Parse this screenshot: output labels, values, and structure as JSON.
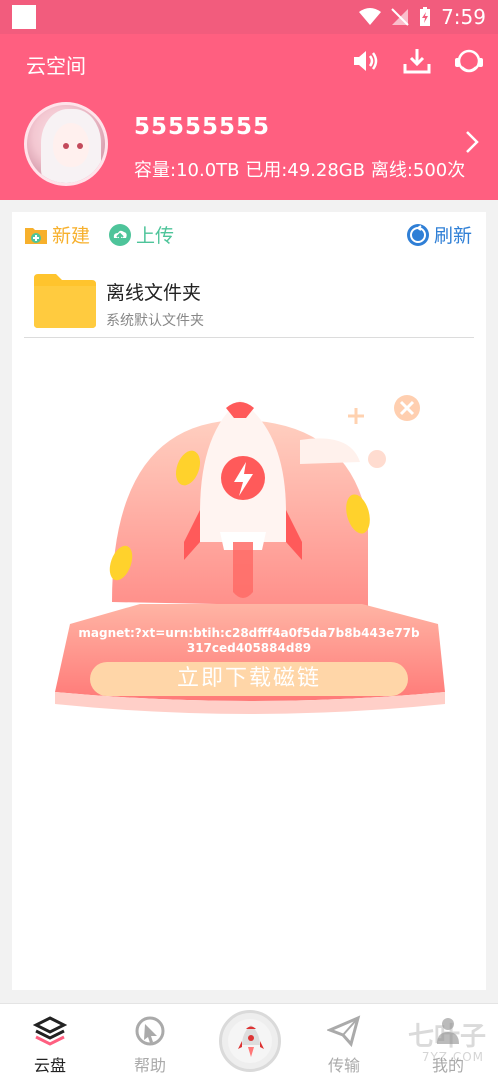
{
  "status_bar": {
    "time": "7:59"
  },
  "header": {
    "title": "云空间",
    "icons": [
      "speaker-icon",
      "download-icon",
      "headset-icon"
    ],
    "username": "55555555",
    "quota": "容量:10.0TB 已用:49.28GB 离线:500次"
  },
  "toolbar": {
    "new_label": "新建",
    "upload_label": "上传",
    "refresh_label": "刷新"
  },
  "folders": [
    {
      "name": "离线文件夹",
      "subtitle": "系统默认文件夹"
    }
  ],
  "promo": {
    "magnet": "magnet:?xt=urn:btih:c28dfff4a0f5da7b8b443e77b317ced405884d89",
    "button_label": "立即下载磁链"
  },
  "tabs": [
    {
      "label": "云盘",
      "icon": "layers-icon",
      "active": true
    },
    {
      "label": "帮助",
      "icon": "help-cursor-icon",
      "active": false
    },
    {
      "label": "",
      "icon": "rocket-icon",
      "active": false
    },
    {
      "label": "传输",
      "icon": "paper-plane-icon",
      "active": false
    },
    {
      "label": "我的",
      "icon": "person-icon",
      "active": false
    }
  ],
  "watermark": {
    "text": "七叶子",
    "sub": "7YZ.COM"
  },
  "colors": {
    "header": "#ff5f80",
    "accent_yellow": "#f7b02c",
    "accent_green": "#4ec49a",
    "accent_blue": "#2f7fd6"
  }
}
